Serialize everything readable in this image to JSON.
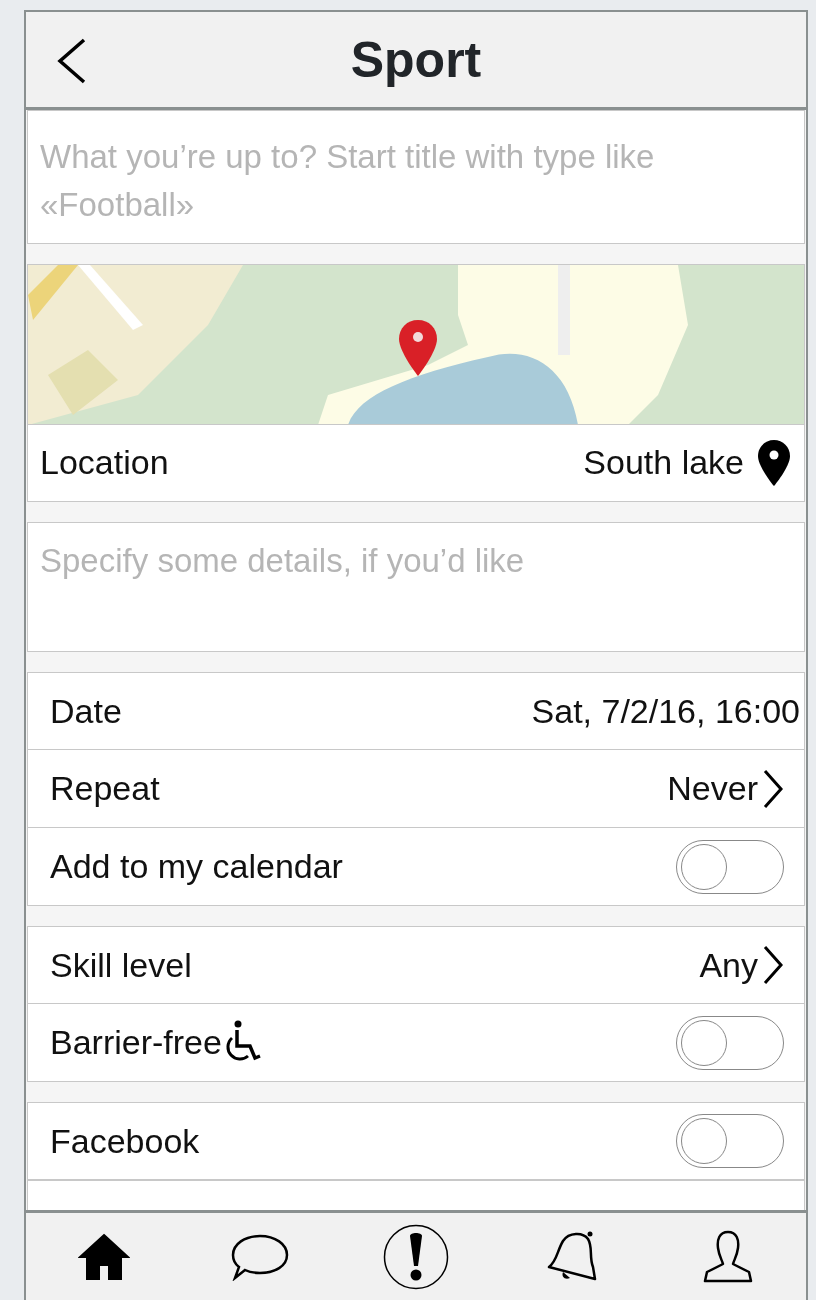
{
  "header": {
    "title": "Sport"
  },
  "title_field": {
    "placeholder": "What you’re up to? Start title with type like «Football»"
  },
  "location": {
    "label": "Location",
    "value": "South lake"
  },
  "details_field": {
    "placeholder": "Specify some details, if you’d like"
  },
  "groups": [
    {
      "rows": [
        {
          "kind": "value",
          "label": "Date",
          "value": "Sat, 7/2/16, 16:00"
        },
        {
          "kind": "link",
          "label": "Repeat",
          "value": "Never"
        },
        {
          "kind": "toggle",
          "label": "Add to my calendar",
          "on": false
        }
      ]
    },
    {
      "rows": [
        {
          "kind": "link",
          "label": "Skill level",
          "value": "Any"
        },
        {
          "kind": "accessible-toggle",
          "label": "Barrier-free",
          "on": false
        }
      ]
    },
    {
      "rows": [
        {
          "kind": "toggle",
          "label": "Facebook",
          "on": false
        }
      ]
    }
  ],
  "tab_bar": [
    {
      "selected": true
    },
    {
      "selected": false
    },
    {
      "selected": false
    },
    {
      "selected": false
    },
    {
      "selected": false
    }
  ]
}
